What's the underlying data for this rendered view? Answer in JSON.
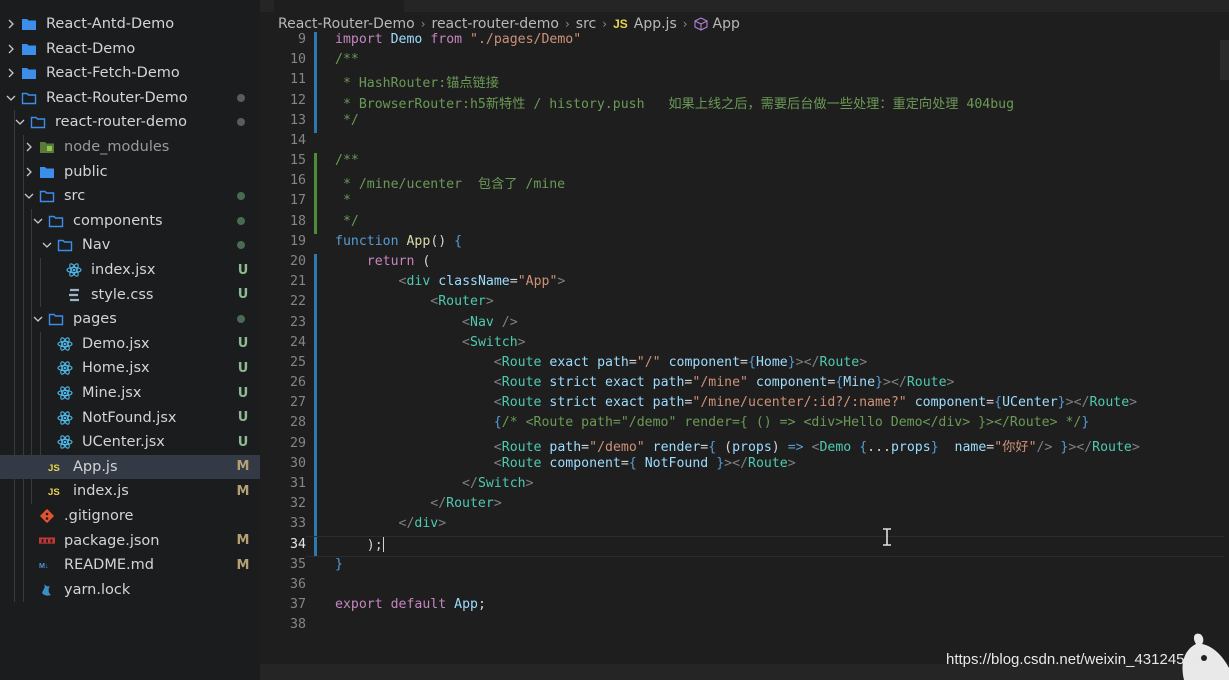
{
  "explorer": {
    "items": [
      {
        "label": "React-Antd-Demo",
        "icon": "folder-icon",
        "expanded": false,
        "status": ""
      },
      {
        "label": "React-Demo",
        "icon": "folder-icon",
        "expanded": false,
        "status": ""
      },
      {
        "label": "React-Fetch-Demo",
        "icon": "folder-icon",
        "expanded": false,
        "status": ""
      },
      {
        "label": "React-Router-Demo",
        "icon": "folder-open-icon",
        "expanded": true,
        "status": "dot"
      },
      {
        "label": "react-router-demo",
        "icon": "folder-open-icon",
        "expanded": true,
        "status": "dot"
      },
      {
        "label": "node_modules",
        "icon": "node-folder-icon",
        "expanded": false,
        "status": ""
      },
      {
        "label": "public",
        "icon": "folder-icon",
        "expanded": false,
        "status": ""
      },
      {
        "label": "src",
        "icon": "folder-open-icon",
        "expanded": true,
        "status": "dot"
      },
      {
        "label": "components",
        "icon": "folder-open-icon",
        "expanded": true,
        "status": "dot"
      },
      {
        "label": "Nav",
        "icon": "folder-open-icon",
        "expanded": true,
        "status": "dot"
      },
      {
        "label": "index.jsx",
        "icon": "react-icon",
        "status": "U"
      },
      {
        "label": "style.css",
        "icon": "css-icon",
        "status": "U"
      },
      {
        "label": "pages",
        "icon": "folder-open-icon",
        "expanded": true,
        "status": "dot"
      },
      {
        "label": "Demo.jsx",
        "icon": "react-icon",
        "status": "U"
      },
      {
        "label": "Home.jsx",
        "icon": "react-icon",
        "status": "U"
      },
      {
        "label": "Mine.jsx",
        "icon": "react-icon",
        "status": "U"
      },
      {
        "label": "NotFound.jsx",
        "icon": "react-icon",
        "status": "U"
      },
      {
        "label": "UCenter.jsx",
        "icon": "react-icon",
        "status": "U"
      },
      {
        "label": "App.js",
        "icon": "js-icon",
        "status": "M",
        "selected": true
      },
      {
        "label": "index.js",
        "icon": "js-icon",
        "status": "M"
      },
      {
        "label": ".gitignore",
        "icon": "git-icon",
        "status": ""
      },
      {
        "label": "package.json",
        "icon": "npm-icon",
        "status": "M"
      },
      {
        "label": "README.md",
        "icon": "markdown-icon",
        "status": "M"
      },
      {
        "label": "yarn.lock",
        "icon": "yarn-icon",
        "status": ""
      }
    ]
  },
  "breadcrumb": {
    "items": [
      "React-Router-Demo",
      "react-router-demo",
      "src",
      "App.js",
      "App"
    ],
    "file_badge": "JS"
  },
  "editor": {
    "active_line": 34,
    "lines": [
      {
        "n": 9,
        "text": "import Demo from \"./pages/Demo\""
      },
      {
        "n": 10,
        "text": "/**"
      },
      {
        "n": 11,
        "text": " * HashRouter:锚点链接"
      },
      {
        "n": 12,
        "text": " * BrowserRouter:h5新特性 / history.push   如果上线之后，需要后台做一些处理：重定向处理 404bug"
      },
      {
        "n": 13,
        "text": " */"
      },
      {
        "n": 14,
        "text": ""
      },
      {
        "n": 15,
        "text": "/**"
      },
      {
        "n": 16,
        "text": " * /mine/ucenter  包含了 /mine"
      },
      {
        "n": 17,
        "text": " *"
      },
      {
        "n": 18,
        "text": " */"
      },
      {
        "n": 19,
        "text": "function App() {"
      },
      {
        "n": 20,
        "text": "    return ("
      },
      {
        "n": 21,
        "text": "        <div className=\"App\">"
      },
      {
        "n": 22,
        "text": "            <Router>"
      },
      {
        "n": 23,
        "text": "                <Nav />"
      },
      {
        "n": 24,
        "text": "                <Switch>"
      },
      {
        "n": 25,
        "text": "                    <Route exact path=\"/\" component={Home}></Route>"
      },
      {
        "n": 26,
        "text": "                    <Route strict exact path=\"/mine\" component={Mine}></Route>"
      },
      {
        "n": 27,
        "text": "                    <Route strict exact path=\"/mine/ucenter/:id?/:name?\" component={UCenter}></Route>"
      },
      {
        "n": 28,
        "text": "                    {/* <Route path=\"/demo\" render={ () => <div>Hello Demo</div> }></Route> */}"
      },
      {
        "n": 29,
        "text": "                    <Route path=\"/demo\" render={ (props) => <Demo {...props}  name=\"你好\"/> }></Route>"
      },
      {
        "n": 30,
        "text": "                    <Route component={ NotFound }></Route>"
      },
      {
        "n": 31,
        "text": "                </Switch>"
      },
      {
        "n": 32,
        "text": "            </Router>"
      },
      {
        "n": 33,
        "text": "        </div>"
      },
      {
        "n": 34,
        "text": "    );"
      },
      {
        "n": 35,
        "text": "}"
      },
      {
        "n": 36,
        "text": ""
      },
      {
        "n": 37,
        "text": "export default App;"
      },
      {
        "n": 38,
        "text": ""
      }
    ]
  },
  "watermark": "https://blog.csdn.net/weixin_43124546",
  "colors": {
    "sidebar_bg": "#1b1c1e",
    "editor_bg": "#1e1e1e",
    "selected_row": "#333a45",
    "folder_blue": "#3b8eea",
    "react_cyan": "#4fb8e6",
    "js_yellow": "#e8d44d"
  }
}
